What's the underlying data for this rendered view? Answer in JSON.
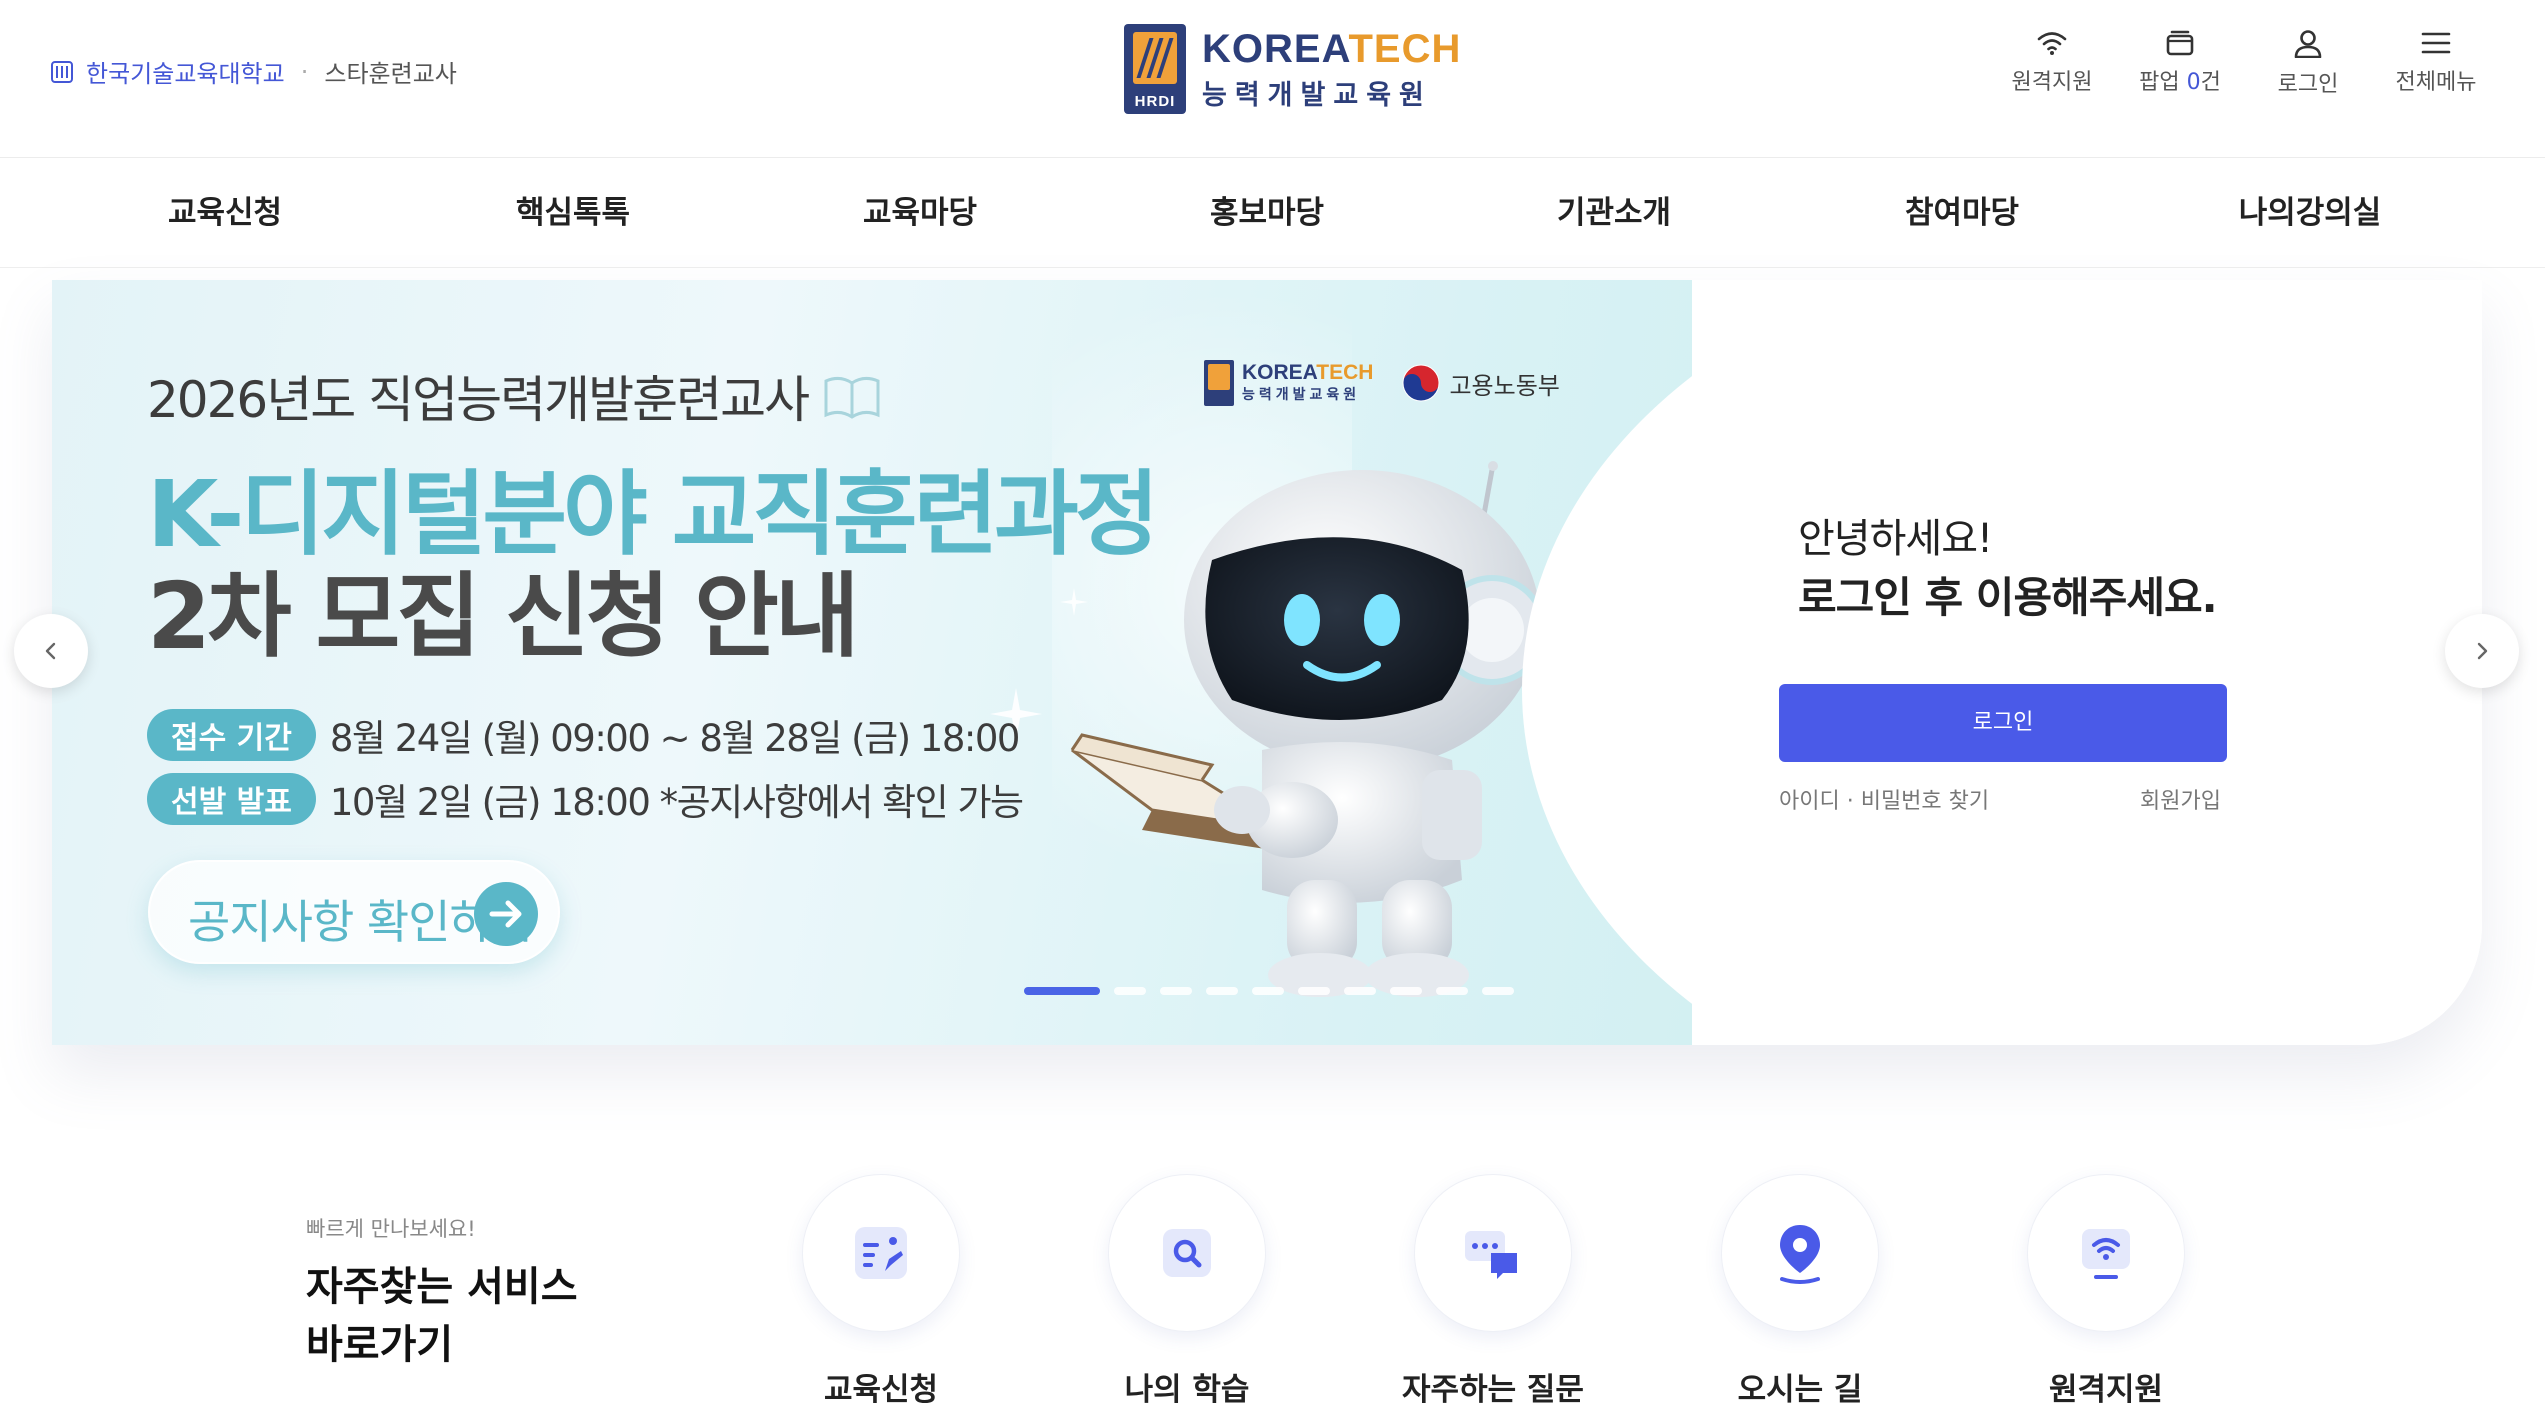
{
  "header": {
    "university_name": "한국기술교육대학교",
    "separator": "·",
    "university_sub": "스타훈련교사",
    "logo": {
      "badge_text": "HRDI",
      "name_en_part1": "KOREA",
      "name_en_part2": "TECH",
      "name_kr": "능력개발교육원"
    },
    "utilities": [
      {
        "label": "원격지원",
        "icon": "wifi-icon"
      },
      {
        "label_prefix": "팝업 ",
        "count": "0",
        "label_suffix": "건",
        "icon": "popup-icon"
      },
      {
        "label": "로그인",
        "icon": "user-icon"
      },
      {
        "label": "전체메뉴",
        "icon": "hamburger-icon"
      }
    ]
  },
  "nav": {
    "items": [
      "교육신청",
      "핵심톡톡",
      "교육마당",
      "홍보마당",
      "기관소개",
      "참여마당",
      "나의강의실"
    ]
  },
  "banner": {
    "year_line": "2026년도 직업능력개발훈련교사",
    "title_line1": "K-디지털분야 교직훈련과정",
    "title_line2": "2차 모집 신청 안내",
    "period_label": "접수 기간",
    "period_value": "8월 24일 (월) 09:00 ~ 8월 28일 (금) 18:00",
    "announce_label": "선발 발표",
    "announce_value": "10월 2일 (금) 18:00   *공지사항에서 확인 가능",
    "cta_label": "공지사항 확인하기",
    "partner_logo_en_part1": "KOREA",
    "partner_logo_en_part2": "TECH",
    "partner_logo_kr": "능력개발교육원",
    "ministry": "고용노동부",
    "slide_count": 10,
    "active_slide": 1
  },
  "login_panel": {
    "greeting": "안녕하세요!",
    "message": "로그인 후 이용해주세요.",
    "login_button": "로그인",
    "find_link": "아이디 · 비밀번호 찾기",
    "join_link": "회원가입"
  },
  "quick": {
    "subtitle": "빠르게 만나보세요!",
    "title_line1": "자주찾는 서비스",
    "title_line2": "바로가기",
    "items": [
      {
        "label": "교육신청",
        "icon": "edit-document-icon"
      },
      {
        "label": "나의 학습",
        "icon": "search-icon"
      },
      {
        "label": "자주하는 질문",
        "icon": "chat-bubbles-icon"
      },
      {
        "label": "오시는 길",
        "icon": "map-pin-icon"
      },
      {
        "label": "원격지원",
        "icon": "remote-wifi-icon"
      }
    ]
  },
  "colors": {
    "accent": "#4a5ae8",
    "banner_teal": "#5ab7c8",
    "brand_navy": "#2d3f7a",
    "brand_orange": "#e89a2c",
    "highlight": "#fdeaa6"
  }
}
